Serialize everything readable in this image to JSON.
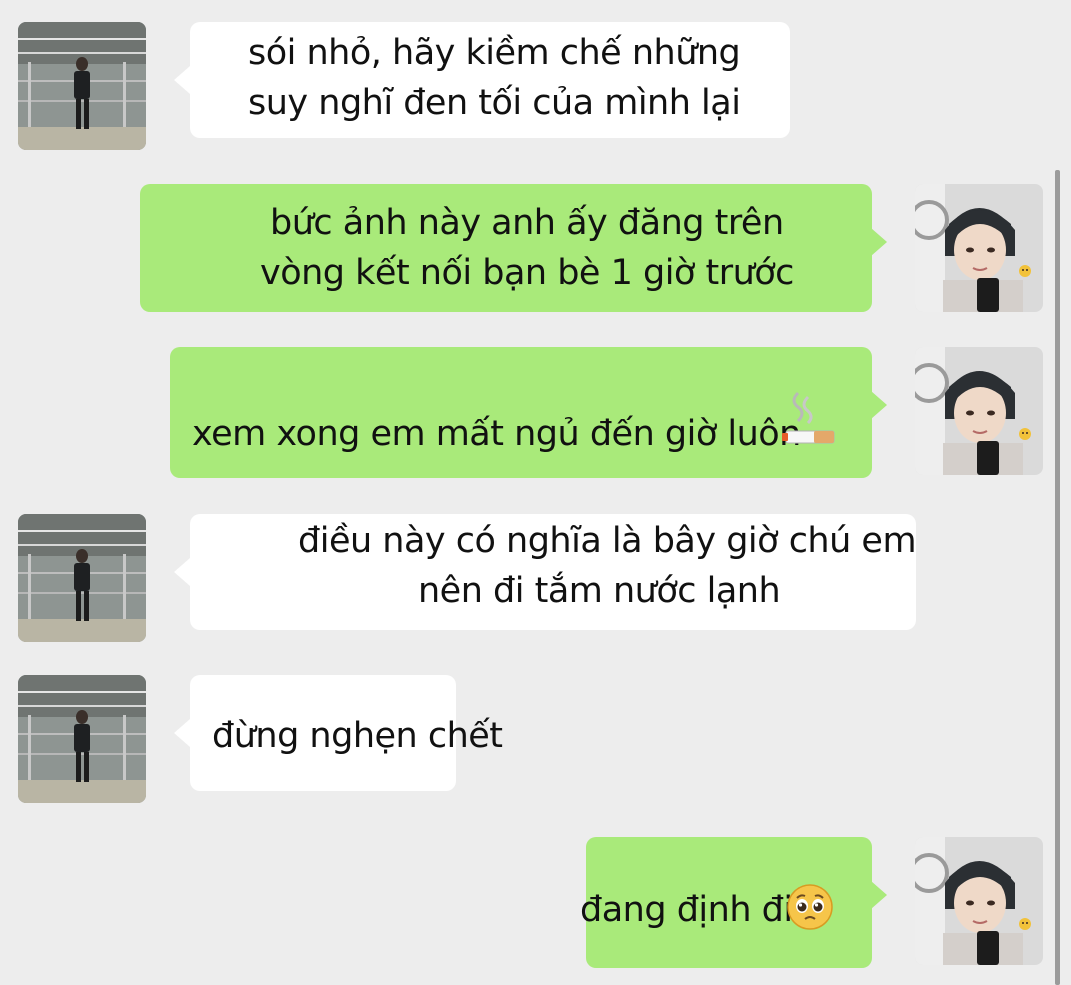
{
  "messages": [
    {
      "id": "m1",
      "direction": "incoming",
      "sender": "contact",
      "lines": [
        "sói nhỏ, hãy kiềm chế những",
        "suy nghĩ đen tối của mình lại"
      ],
      "emoji": ""
    },
    {
      "id": "m2",
      "direction": "outgoing",
      "sender": "self",
      "lines": [
        "bức ảnh này anh ấy đăng trên",
        "vòng kết nối bạn bè 1 giờ trước"
      ],
      "emoji": ""
    },
    {
      "id": "m3",
      "direction": "outgoing",
      "sender": "self",
      "lines": [
        "xem xong em mất ngủ đến giờ luôn"
      ],
      "emoji": "smoking-icon"
    },
    {
      "id": "m4",
      "direction": "incoming",
      "sender": "contact",
      "lines": [
        "điều này có nghĩa là bây giờ chú em",
        "nên đi tắm nước lạnh"
      ],
      "emoji": ""
    },
    {
      "id": "m5",
      "direction": "incoming",
      "sender": "contact",
      "lines": [
        "đừng nghẹn chết"
      ],
      "emoji": ""
    },
    {
      "id": "m6",
      "direction": "outgoing",
      "sender": "self",
      "lines": [
        "đang định đi"
      ],
      "emoji": "pleading-face-icon"
    }
  ],
  "colors": {
    "background": "#ededed",
    "incoming_bubble": "#ffffff",
    "outgoing_bubble": "#a9ea7a",
    "text": "#111111",
    "scrollbar": "#9b9b9b"
  }
}
